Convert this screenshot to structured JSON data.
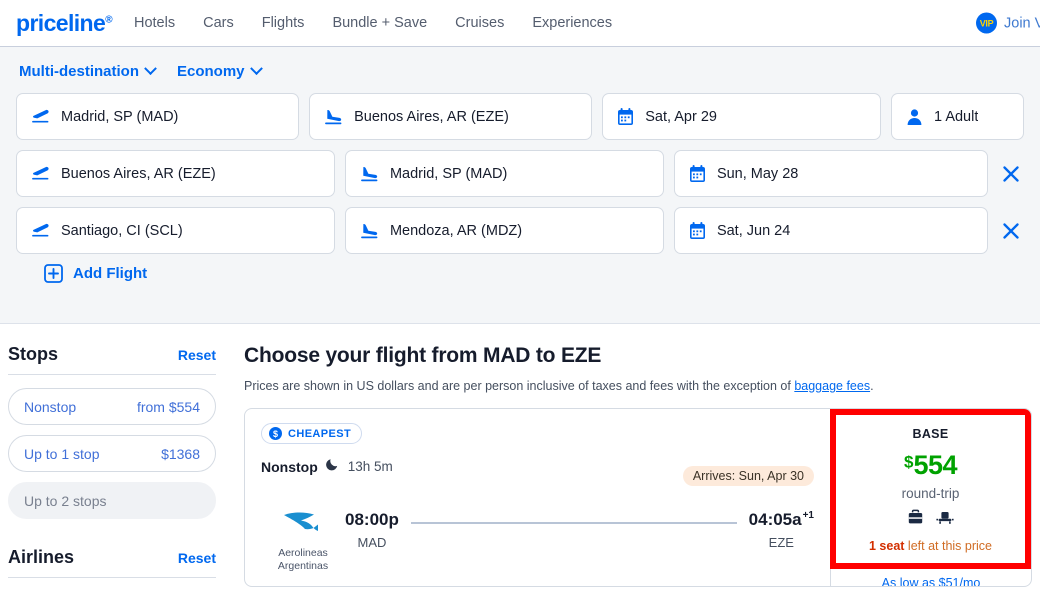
{
  "header": {
    "logo": "priceline",
    "logo_mark": "registered-trademark",
    "nav": [
      {
        "label": "Hotels",
        "name": "nav-hotels"
      },
      {
        "label": "Cars",
        "name": "nav-cars"
      },
      {
        "label": "Flights",
        "name": "nav-flights"
      },
      {
        "label": "Bundle + Save",
        "name": "nav-bundle-save"
      },
      {
        "label": "Cruises",
        "name": "nav-cruises"
      },
      {
        "label": "Experiences",
        "name": "nav-experiences"
      }
    ],
    "vip_badge": "VIP",
    "vip_label": "Join VIP"
  },
  "search": {
    "trip_type": "Multi-destination",
    "cabin_class": "Economy",
    "passengers": "1 Adult",
    "add_flight_label": "Add Flight",
    "legs": [
      {
        "origin": "Madrid, SP (MAD)",
        "destination": "Buenos Aires, AR (EZE)",
        "date": "Sat, Apr 29",
        "removable": false
      },
      {
        "origin": "Buenos Aires, AR (EZE)",
        "destination": "Madrid, SP (MAD)",
        "date": "Sun, May 28",
        "removable": true
      },
      {
        "origin": "Santiago, CI (SCL)",
        "destination": "Mendoza, AR (MDZ)",
        "date": "Sat, Jun 24",
        "removable": true
      }
    ]
  },
  "sidebar": {
    "stops": {
      "title": "Stops",
      "reset": "Reset",
      "options": [
        {
          "label": "Nonstop",
          "price": "from $554",
          "enabled": true
        },
        {
          "label": "Up to 1 stop",
          "price": "$1368",
          "enabled": true
        },
        {
          "label": "Up to 2 stops",
          "price": "",
          "enabled": false
        }
      ]
    },
    "airlines": {
      "title": "Airlines",
      "reset": "Reset"
    }
  },
  "main": {
    "title": "Choose your flight from MAD to EZE",
    "subtitle_before": "Prices are shown in US dollars and are per person inclusive of taxes and fees with the exception of ",
    "subtitle_link": "baggage fees",
    "subtitle_after": ".",
    "result": {
      "badge": "CHEAPEST",
      "stops": "Nonstop",
      "overnight_icon": "moon-icon",
      "duration": "13h 5m",
      "arrives": "Arrives: Sun, Apr 30",
      "airline": "Aerolineas Argentinas",
      "depart_time": "08:00p",
      "depart_code": "MAD",
      "arrive_time": "04:05a",
      "arrive_day_offset": "+1",
      "arrive_code": "EZE",
      "fare_label": "BASE",
      "currency": "$",
      "price": "554",
      "trip_type": "round-trip",
      "amenities": [
        "carry-on-bag-icon",
        "seat-icon"
      ],
      "seats_left_bold": "1 seat",
      "seats_left_rest": " left at this price",
      "financing": "As low as $51/mo"
    }
  },
  "colors": {
    "brand_blue": "#0068ef",
    "price_green": "#00a200",
    "highlight_red": "#ff0000",
    "arrives_bg": "#fdeadb"
  }
}
